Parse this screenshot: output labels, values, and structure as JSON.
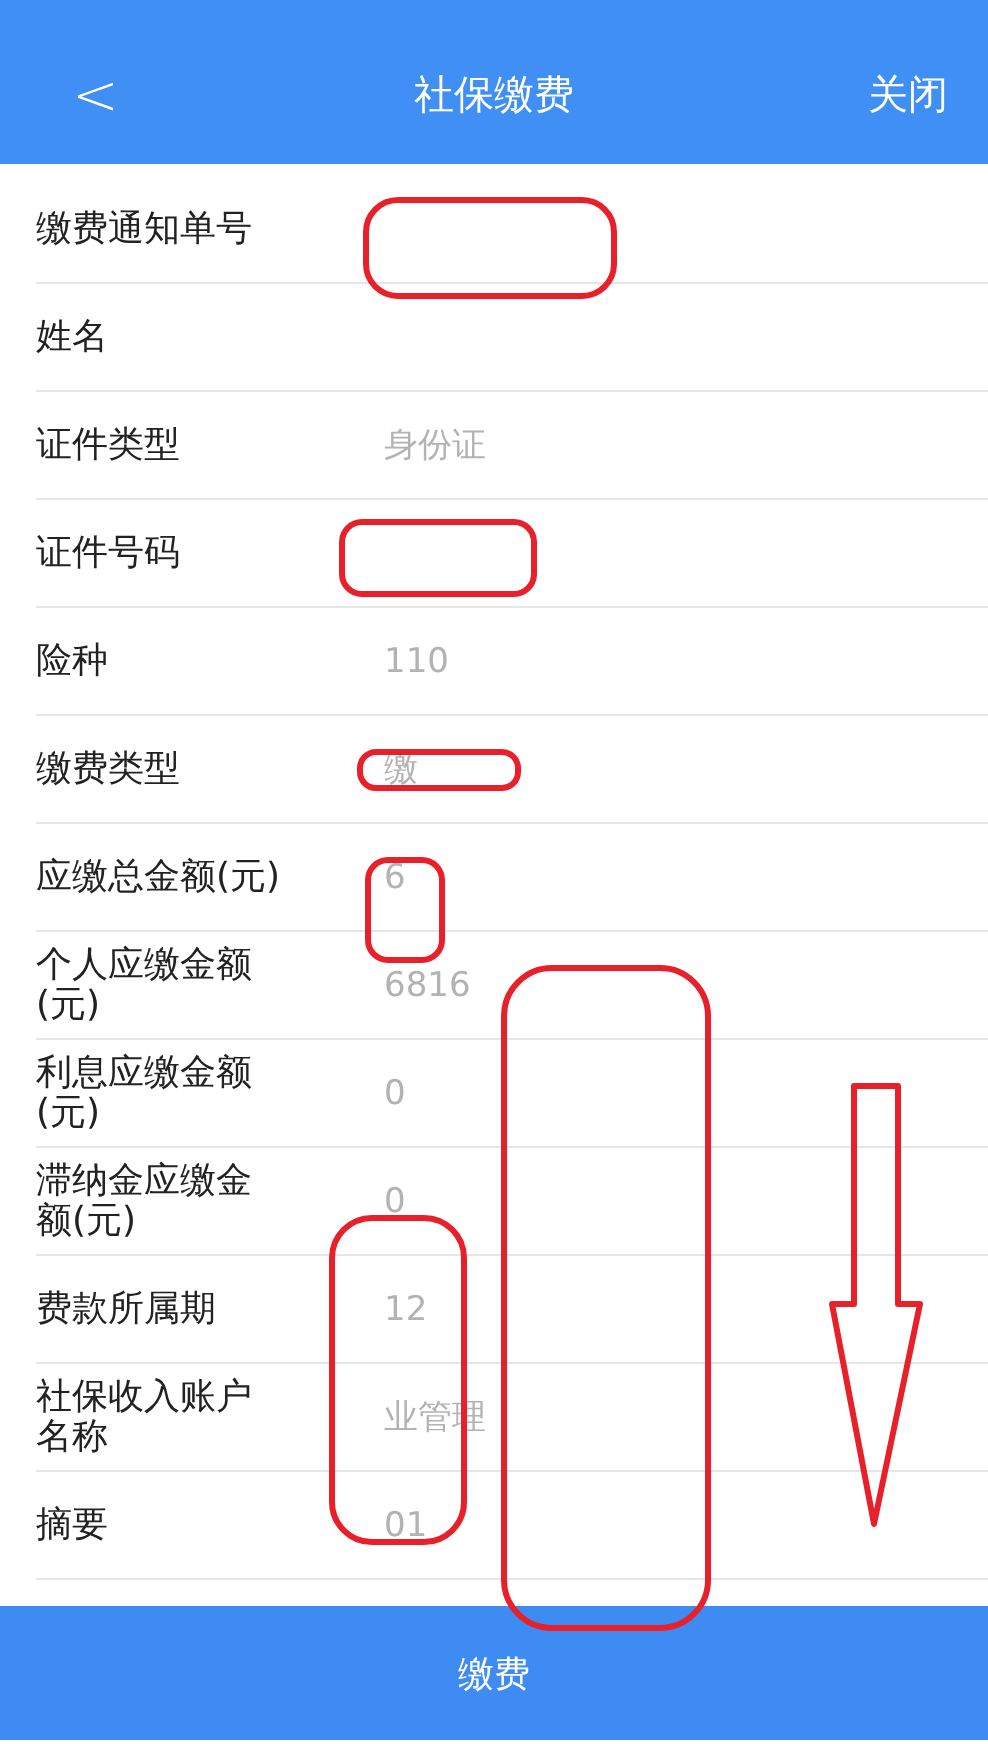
{
  "header": {
    "back": "<",
    "title": "社保缴费",
    "close": "关闭"
  },
  "rows": [
    {
      "label": "缴费通知单号"
    },
    {
      "label": "姓名"
    },
    {
      "label": "证件类型",
      "value": "身份证"
    },
    {
      "label": "证件号码"
    },
    {
      "label": "险种",
      "value": "110"
    },
    {
      "label": "缴费类型",
      "value": "缴"
    },
    {
      "label": "应缴总金额(元)",
      "value": "6"
    },
    {
      "label": "个人应缴金额(元)",
      "value": "6816"
    },
    {
      "label": "利息应缴金额(元)",
      "value": "0"
    },
    {
      "label": "滞纳金应缴金额(元)",
      "value": "0"
    },
    {
      "label": "费款所属期",
      "value": "12"
    },
    {
      "label": "社保收入账户名称",
      "value": "业管理"
    },
    {
      "label": "摘要",
      "value": "01"
    }
  ],
  "submit": "缴费"
}
